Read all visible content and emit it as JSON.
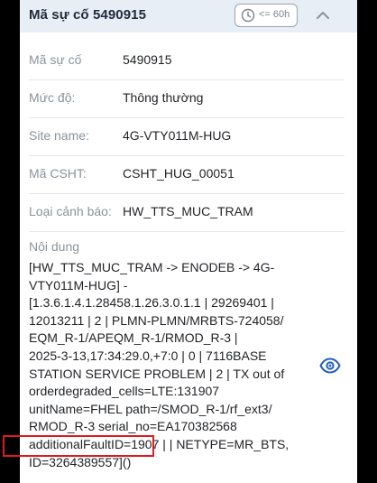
{
  "header": {
    "title": "Mã sự cố 5490915",
    "time_filter_label": "<= 60h",
    "time_filter_icon": "clock-icon",
    "collapse_icon": "chevron-up-icon"
  },
  "fields": [
    {
      "label": "Mã sự cố",
      "value": "5490915"
    },
    {
      "label": "Mức độ:",
      "value": "Thông thường"
    },
    {
      "label": "Site name:",
      "value": "4G-VTY011M-HUG"
    },
    {
      "label": "Mã CSHT:",
      "value": "CSHT_HUG_00051"
    },
    {
      "label": "Loại cảnh báo:",
      "value": "HW_TTS_MUC_TRAM"
    }
  ],
  "content": {
    "label": "Nội dung",
    "lines": [
      "[HW_TTS_MUC_TRAM -> ENODEB -> 4G-",
      "VTY011M-HUG] -",
      "[1.3.6.1.4.1.28458.1.26.3.0.1.1 | 29269401 |",
      "12013211 | 2 | PLMN-PLMN/MRBTS-724058/",
      "EQM_R-1/APEQM_R-1/RMOD_R-3 |",
      "2025-3-13,17:34:29.0,+7:0 | 0 | 7116BASE",
      "STATION SERVICE PROBLEM | 2 | TX out of",
      "orderdegraded_cells=LTE:131907",
      "unitName=FHEL path=/SMOD_R-1/rf_ext3/",
      "RMOD_R-3 serial_no=EA170382568",
      "additionalFaultID=1907 |  | NETYPE=MR_BTS,",
      "ID=3264389557]()"
    ],
    "view_icon": "eye-icon"
  },
  "colors": {
    "accent": "#1f5fbf",
    "header_bg": "#e8eef6",
    "highlight": "#e0191f"
  }
}
